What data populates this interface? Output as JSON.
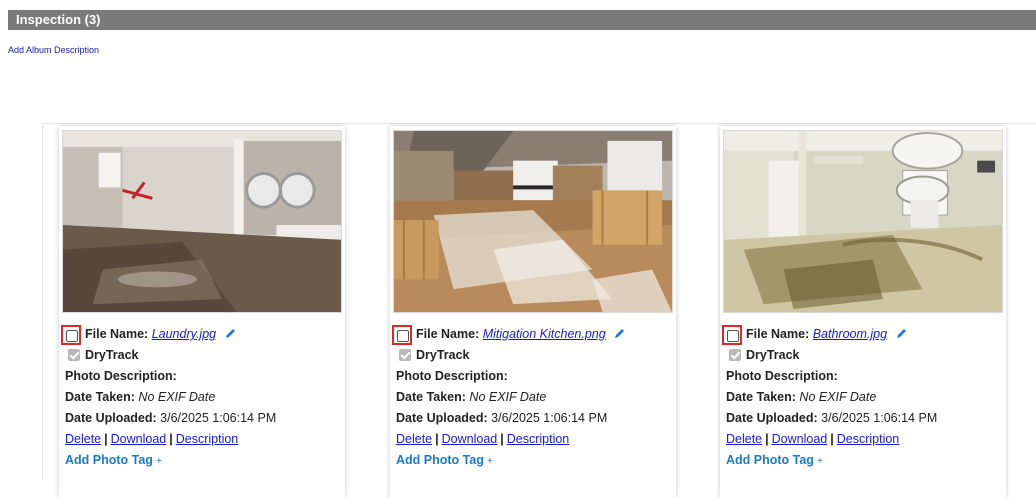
{
  "album": {
    "title": "Inspection (3)",
    "add_description_link": "Add Album Description"
  },
  "labels": {
    "file_name": "File Name:",
    "drytrack": "DryTrack",
    "photo_description": "Photo Description:",
    "date_taken": "Date Taken:",
    "date_uploaded": "Date Uploaded:",
    "delete": "Delete",
    "download": "Download",
    "description": "Description",
    "add_photo_tag": "Add Photo Tag",
    "separator": "|",
    "plus": "+"
  },
  "photos": [
    {
      "file_name": "Laundry.jpg",
      "date_taken": "No EXIF Date",
      "date_uploaded": "3/6/2025 1:06:14 PM",
      "scene": "laundry-room-flooded-floor",
      "selected": false,
      "drytrack_checked": true
    },
    {
      "file_name": "Mitigation Kitchen.png",
      "date_taken": "No EXIF Date",
      "date_uploaded": "3/6/2025 1:06:14 PM",
      "scene": "kitchen-collapsed-ceiling",
      "selected": false,
      "drytrack_checked": true
    },
    {
      "file_name": "Bathroom.jpg",
      "date_taken": "No EXIF Date",
      "date_uploaded": "3/6/2025 1:06:14 PM",
      "scene": "bathroom-water-damage",
      "selected": false,
      "drytrack_checked": true
    }
  ],
  "colors": {
    "header_bg": "#7a7a7a",
    "link": "#1a1ad6",
    "tag_link": "#1a7bc9",
    "highlight": "#e0262b"
  }
}
